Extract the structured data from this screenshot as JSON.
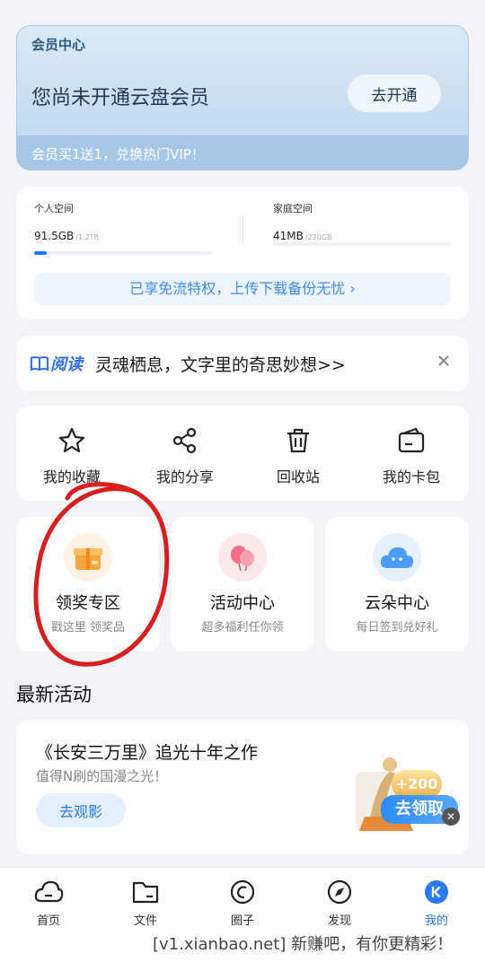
{
  "vip": {
    "title": "会员中心",
    "main": "您尚未开通云盘会员",
    "button": "去开通",
    "sub": "会员买1送1，兑换热门VIP！"
  },
  "storage": {
    "personal": {
      "label": "个人空间",
      "used": "91.5GB",
      "total": "/1.2TB",
      "fill_ratio": 0.07
    },
    "family": {
      "label": "家庭空间",
      "used": "41MB",
      "total": "/220GB",
      "fill_ratio": 0.0
    },
    "promo": "已享免流特权，上传下载备份无忧 ›"
  },
  "reading": {
    "brand": "阅读",
    "text": "灵魂栖息，文字里的奇思妙想>>"
  },
  "tools": [
    {
      "label": "我的收藏",
      "icon": "star-icon"
    },
    {
      "label": "我的分享",
      "icon": "share-icon"
    },
    {
      "label": "回收站",
      "icon": "trash-icon"
    },
    {
      "label": "我的卡包",
      "icon": "card-wallet-icon"
    }
  ],
  "promos": [
    {
      "title": "领奖专区",
      "sub": "戳这里 领奖品",
      "icon": "gift-box-icon"
    },
    {
      "title": "活动中心",
      "sub": "超多福利任你领",
      "icon": "balloon-icon"
    },
    {
      "title": "云朵中心",
      "sub": "每日签到兑好礼",
      "icon": "cloud-icon"
    }
  ],
  "latest": {
    "section_title": "最新活动",
    "title": "《长安三万里》追光十年之作",
    "sub": "值得N刷的国漫之光！",
    "button": "去观影",
    "badge": "+200",
    "claim": "去领取"
  },
  "tabbar": [
    {
      "label": "首页",
      "icon": "cloud-home-icon",
      "active": false
    },
    {
      "label": "文件",
      "icon": "folder-icon",
      "active": false
    },
    {
      "label": "圈子",
      "icon": "circle-icon",
      "active": false
    },
    {
      "label": "发现",
      "icon": "compass-icon",
      "active": false
    },
    {
      "label": "我的",
      "icon": "profile-icon",
      "active": true
    }
  ],
  "watermark": "[v1.xianbao.net] 新赚吧，有你更精彩！",
  "colors": {
    "accent": "#2b78f0",
    "annotation": "#d81e1e"
  }
}
